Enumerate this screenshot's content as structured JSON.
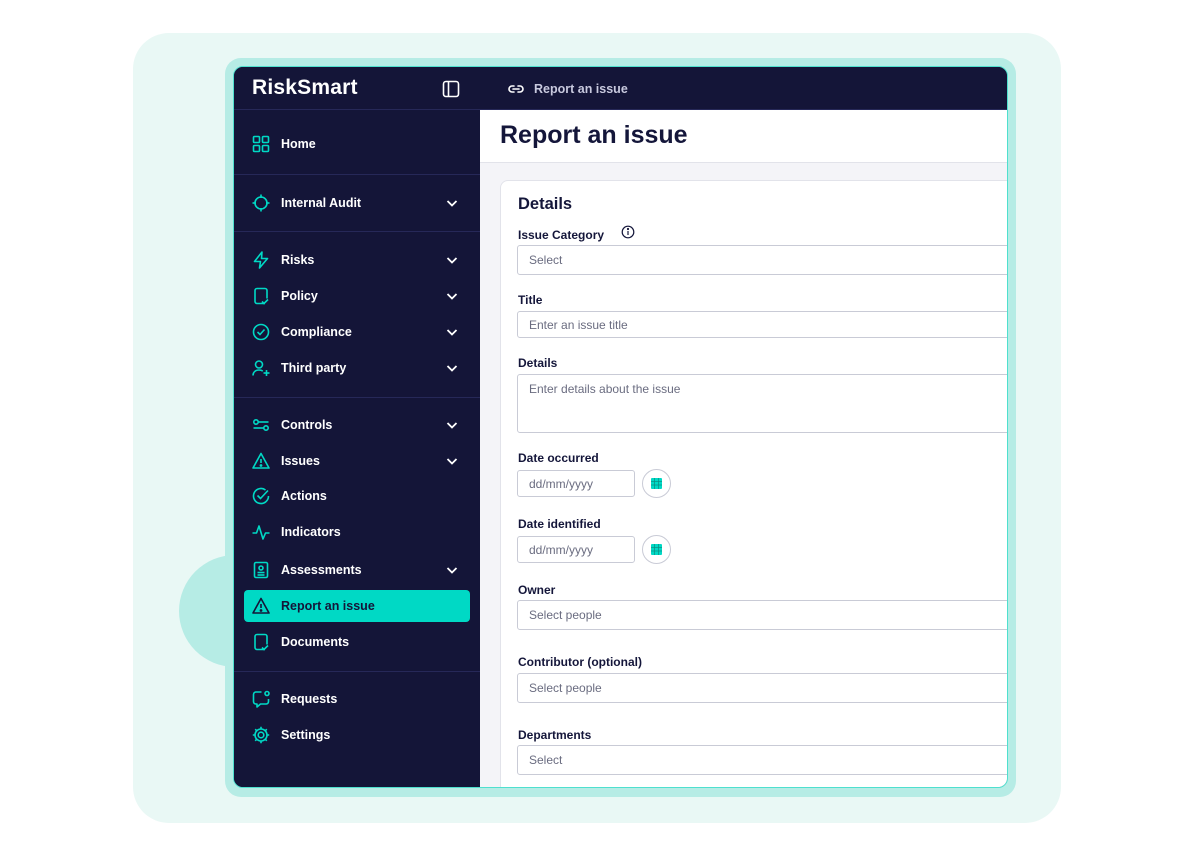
{
  "app": {
    "logo": "RiskSmart"
  },
  "breadcrumb": {
    "label": "Report an issue"
  },
  "sidebar": {
    "items": [
      {
        "label": "Home",
        "icon": "grid-icon"
      },
      {
        "label": "Internal Audit",
        "icon": "target-icon"
      },
      {
        "label": "Risks",
        "icon": "lightning-icon"
      },
      {
        "label": "Policy",
        "icon": "document-check-icon"
      },
      {
        "label": "Compliance",
        "icon": "check-circle-icon"
      },
      {
        "label": "Third party",
        "icon": "user-plus-icon"
      },
      {
        "label": "Controls",
        "icon": "toggle-icon"
      },
      {
        "label": "Issues",
        "icon": "warning-icon"
      },
      {
        "label": "Actions",
        "icon": "check-circle-icon"
      },
      {
        "label": "Indicators",
        "icon": "pulse-icon"
      },
      {
        "label": "Assessments",
        "icon": "clipboard-icon"
      },
      {
        "label": "Report an issue",
        "icon": "warning-icon"
      },
      {
        "label": "Documents",
        "icon": "document-icon"
      },
      {
        "label": "Requests",
        "icon": "chat-icon"
      },
      {
        "label": "Settings",
        "icon": "gear-icon"
      }
    ]
  },
  "page": {
    "title": "Report an issue"
  },
  "form": {
    "section_title": "Details",
    "issue_category": {
      "label": "Issue Category",
      "placeholder": "Select"
    },
    "title": {
      "label": "Title",
      "placeholder": "Enter an issue title"
    },
    "details": {
      "label": "Details",
      "placeholder": "Enter details about the issue"
    },
    "date_occurred": {
      "label": "Date occurred",
      "placeholder": "dd/mm/yyyy"
    },
    "date_identified": {
      "label": "Date identified",
      "placeholder": "dd/mm/yyyy"
    },
    "owner": {
      "label": "Owner",
      "placeholder": "Select people"
    },
    "contributor": {
      "label": "Contributor (optional)",
      "placeholder": "Select people"
    },
    "departments": {
      "label": "Departments",
      "placeholder": "Select"
    }
  },
  "colors": {
    "navy": "#141538",
    "accent": "#00d9c5",
    "backdrop": "#e9f8f5"
  }
}
